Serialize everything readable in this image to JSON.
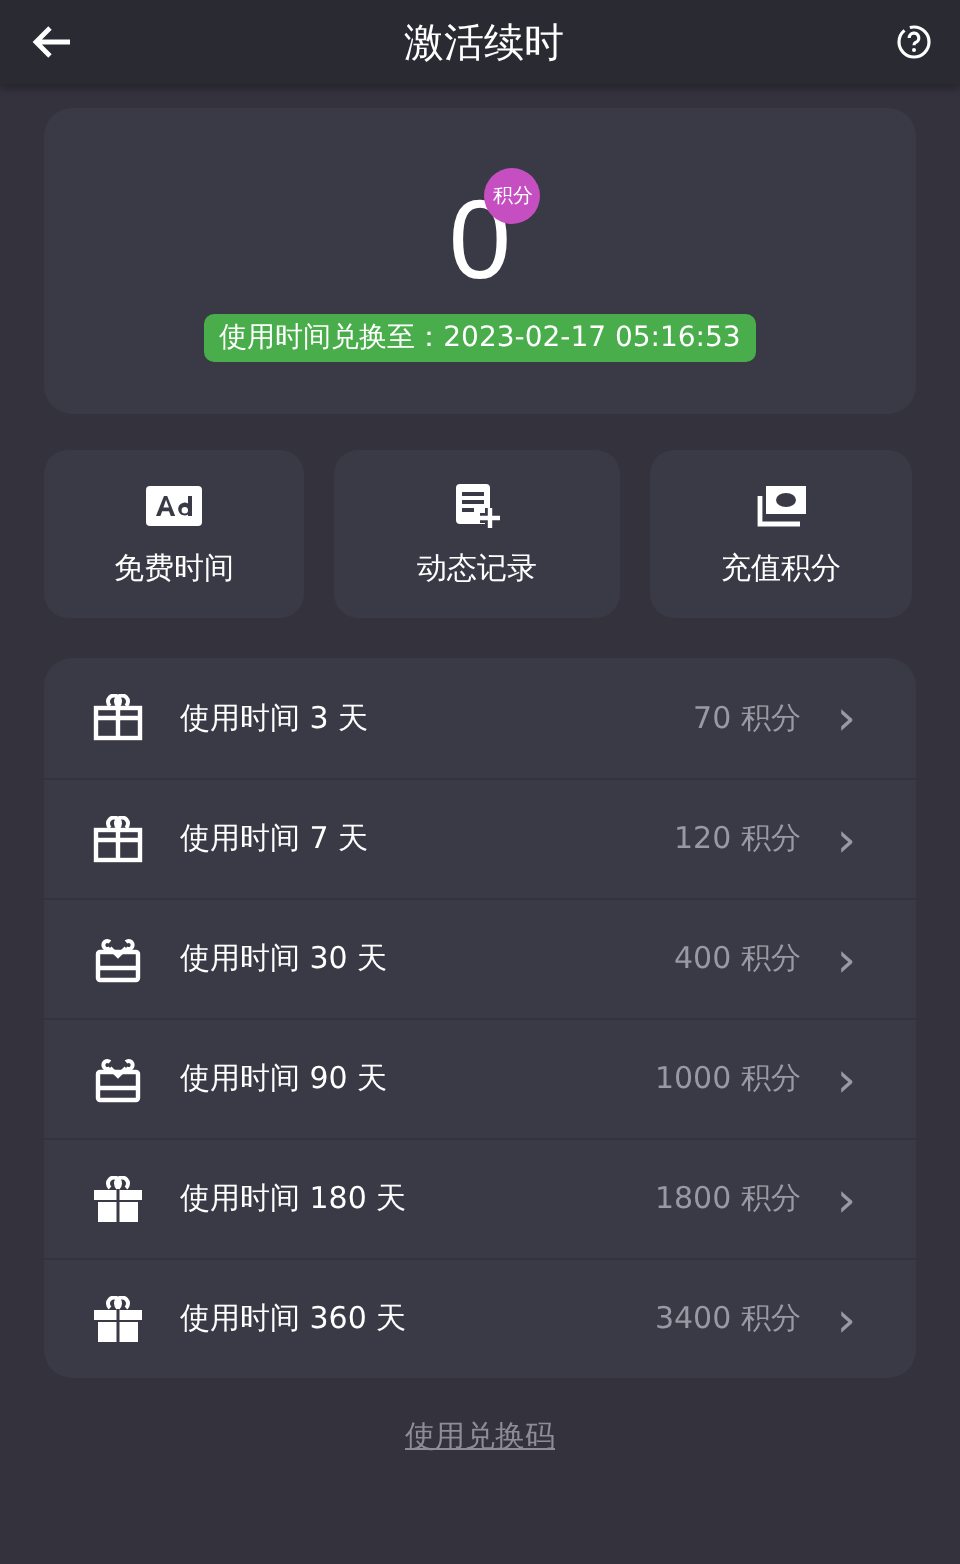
{
  "header": {
    "title": "激活续时"
  },
  "points": {
    "value": "0",
    "badge": "积分",
    "expiry": "使用时间兑换至：2023-02-17 05:16:53"
  },
  "actions": [
    {
      "kind": "ad",
      "label": "免费时间"
    },
    {
      "kind": "record",
      "label": "动态记录"
    },
    {
      "kind": "money",
      "label": "充值积分"
    }
  ],
  "plans": [
    {
      "kind": "outline",
      "label": "使用时间 3 天",
      "price": "70 积分",
      "chevron": "›"
    },
    {
      "kind": "outline",
      "label": "使用时间 7 天",
      "price": "120 积分",
      "chevron": "›"
    },
    {
      "kind": "box",
      "label": "使用时间 30 天",
      "price": "400 积分",
      "chevron": "›"
    },
    {
      "kind": "box",
      "label": "使用时间 90 天",
      "price": "1000 积分",
      "chevron": "›"
    },
    {
      "kind": "filled",
      "label": "使用时间 180 天",
      "price": "1800 积分",
      "chevron": "›"
    },
    {
      "kind": "filled",
      "label": "使用时间 360 天",
      "price": "3400 积分",
      "chevron": "›"
    }
  ],
  "redeem_link": "使用兑换码"
}
